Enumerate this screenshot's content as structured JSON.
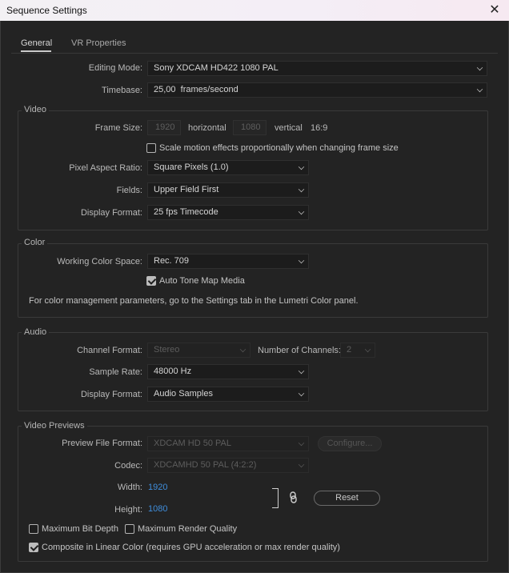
{
  "window": {
    "title": "Sequence Settings",
    "close_icon": "close-icon"
  },
  "tabs": [
    {
      "label": "General",
      "active": true
    },
    {
      "label": "VR Properties",
      "active": false
    }
  ],
  "general": {
    "editing_mode": {
      "label": "Editing Mode:",
      "value": "Sony XDCAM HD422 1080 PAL"
    },
    "timebase": {
      "label": "Timebase:",
      "value": "25,00  frames/second"
    }
  },
  "video": {
    "section_title": "Video",
    "frame_size": {
      "label": "Frame Size:",
      "width": "1920",
      "horizontal_label": "horizontal",
      "height": "1080",
      "vertical_label": "vertical",
      "aspect": "16:9"
    },
    "scale_motion": {
      "label": "Scale motion effects proportionally when changing frame size",
      "checked": false
    },
    "pixel_aspect_ratio": {
      "label": "Pixel Aspect Ratio:",
      "value": "Square Pixels (1.0)"
    },
    "fields": {
      "label": "Fields:",
      "value": "Upper Field First"
    },
    "display_format": {
      "label": "Display Format:",
      "value": "25 fps Timecode"
    }
  },
  "color": {
    "section_title": "Color",
    "working_color_space": {
      "label": "Working Color Space:",
      "value": "Rec. 709"
    },
    "auto_tone_map": {
      "label": "Auto Tone Map Media",
      "checked": true
    },
    "info": "For color management parameters, go to the Settings tab in the Lumetri Color panel."
  },
  "audio": {
    "section_title": "Audio",
    "channel_format": {
      "label": "Channel Format:",
      "value": "Stereo"
    },
    "number_of_channels": {
      "label": "Number of Channels:",
      "value": "2"
    },
    "sample_rate": {
      "label": "Sample Rate:",
      "value": "48000 Hz"
    },
    "display_format": {
      "label": "Display Format:",
      "value": "Audio Samples"
    }
  },
  "video_previews": {
    "section_title": "Video Previews",
    "preview_file_format": {
      "label": "Preview File Format:",
      "value": "XDCAM HD 50 PAL"
    },
    "configure_label": "Configure...",
    "codec": {
      "label": "Codec:",
      "value": "XDCAMHD 50 PAL (4:2:2)"
    },
    "width": {
      "label": "Width:",
      "value": "1920"
    },
    "height": {
      "label": "Height:",
      "value": "1080"
    },
    "reset_label": "Reset",
    "link_icon": "link-icon"
  },
  "options": {
    "max_bit_depth": {
      "label": "Maximum Bit Depth",
      "checked": false
    },
    "max_render_quality": {
      "label": "Maximum Render Quality",
      "checked": false
    },
    "composite_linear": {
      "label": "Composite in Linear Color (requires GPU acceleration or max render quality)",
      "checked": true
    }
  }
}
